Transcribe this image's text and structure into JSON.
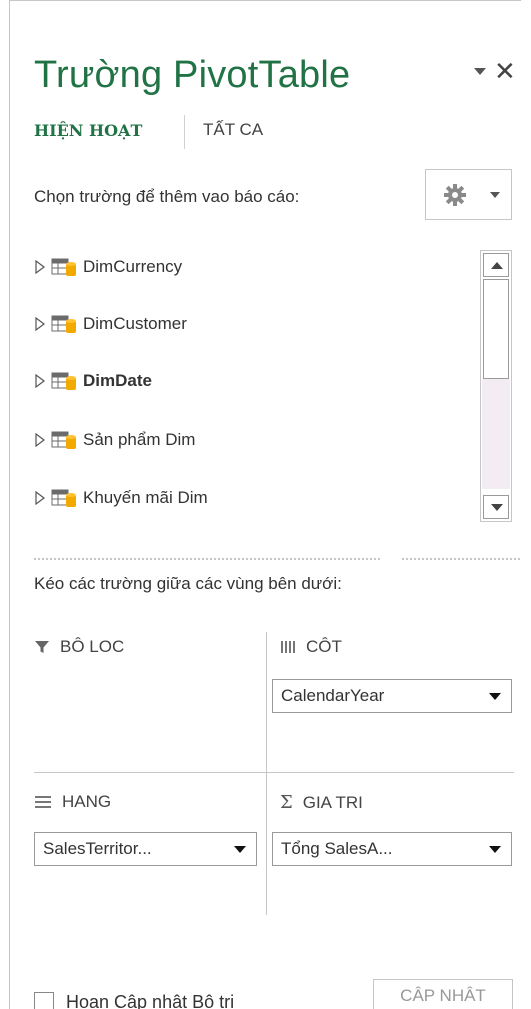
{
  "panel": {
    "title": "Trường PivotTable",
    "tabs": [
      {
        "label": "HIỆN HOẠT",
        "active": true
      },
      {
        "label": "TẤT CA",
        "active": false
      }
    ],
    "choose_fields_label": "Chọn trường để thêm vao báo cáo:",
    "tools_icon": "gear-icon",
    "accent_color": "#217346"
  },
  "fields": [
    {
      "label": "DimCurrency",
      "bold": false
    },
    {
      "label": "DimCustomer",
      "bold": false
    },
    {
      "label": "DimDate",
      "bold": true
    },
    {
      "label": "Sản phẩm Dim",
      "bold": false
    },
    {
      "label": "Khuyến mãi Dim",
      "bold": false
    }
  ],
  "areas": {
    "drag_label": "Kéo các trường giữa các vùng bên dưới:",
    "filters": {
      "label": "BÔ LOC",
      "icon": "filter-icon"
    },
    "columns": {
      "label": "CÔT",
      "icon": "columns-icon",
      "value": "CalendarYear"
    },
    "rows": {
      "label": "HANG",
      "icon": "rows-icon",
      "value": "SalesTerritor..."
    },
    "values": {
      "label": "GIA TRI",
      "icon": "sigma-icon",
      "value": "Tổng SalesA..."
    }
  },
  "footer": {
    "defer_label": "Hoan Câp nhât Bô tri",
    "update_label": "CÂP NHÂT"
  }
}
